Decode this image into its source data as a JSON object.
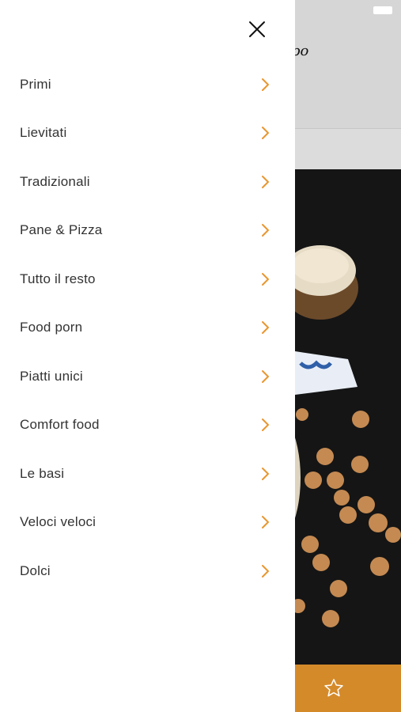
{
  "drawer": {
    "close_icon": "close-icon",
    "items": [
      {
        "label": "Primi"
      },
      {
        "label": "Lievitati"
      },
      {
        "label": "Tradizionali"
      },
      {
        "label": "Pane & Pizza"
      },
      {
        "label": "Tutto il resto"
      },
      {
        "label": "Food porn"
      },
      {
        "label": "Piatti unici"
      },
      {
        "label": "Comfort food"
      },
      {
        "label": "Le basi"
      },
      {
        "label": "Veloci veloci"
      },
      {
        "label": "Dolci"
      }
    ],
    "chevron_icon": "chevron-right-icon",
    "accent_color": "#e8962f"
  },
  "background": {
    "logo_fragment": "po",
    "footer_color": "#d58a2a",
    "favorite_icon": "star-icon"
  }
}
